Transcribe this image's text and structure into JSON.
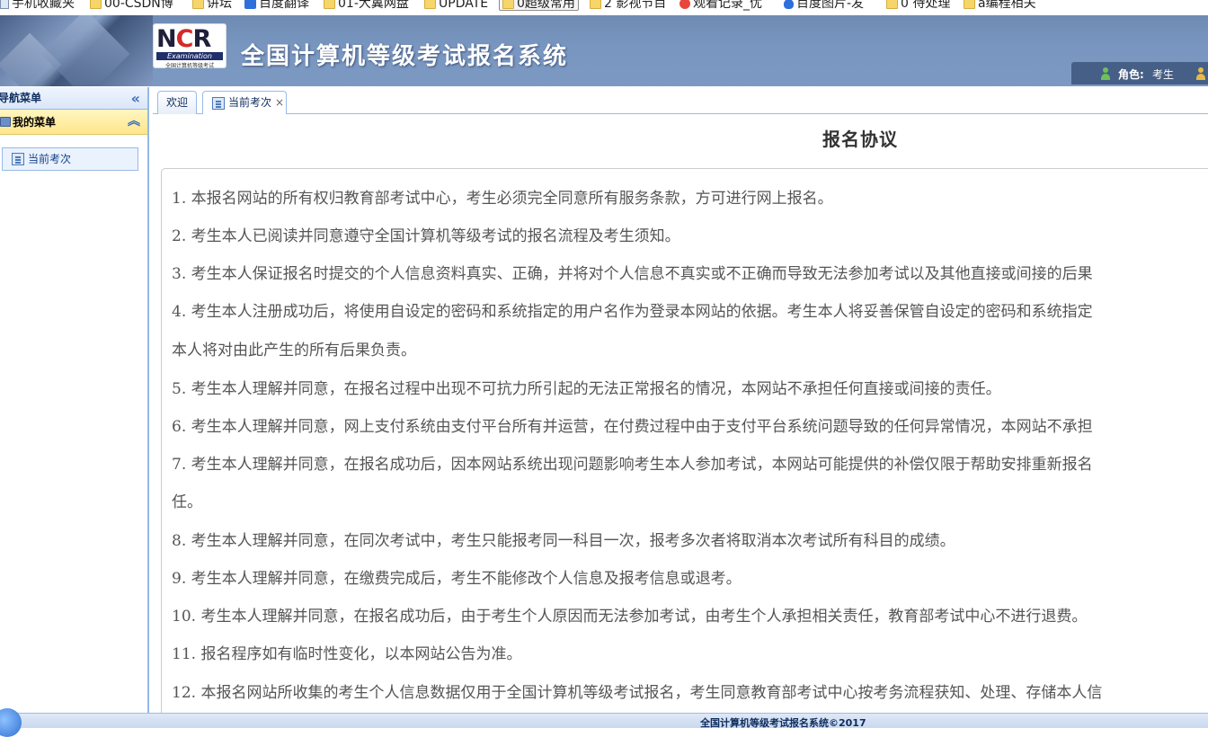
{
  "bookmarks": [
    {
      "label": "手机收藏夹",
      "icon": "page-icon"
    },
    {
      "label": "00-CSDN博",
      "icon": "folder-icon"
    },
    {
      "label": "讲坛",
      "icon": "folder-icon"
    },
    {
      "label": "百度翻译",
      "icon": "baidu-translate-icon"
    },
    {
      "label": "01-大翼网盘",
      "icon": "folder-icon"
    },
    {
      "label": "UPDATE",
      "icon": "folder-icon"
    },
    {
      "label": "0超级常用",
      "icon": "folder-icon"
    },
    {
      "label": "2 影视节目",
      "icon": "folder-icon"
    },
    {
      "label": "观看记录_优",
      "icon": "youku-icon"
    },
    {
      "label": "百度图片-发",
      "icon": "baidu-paw-icon"
    },
    {
      "label": "0 待处理",
      "icon": "folder-icon"
    },
    {
      "label": "a编程相关",
      "icon": "folder-icon"
    }
  ],
  "header": {
    "logo": {
      "letters": "NCR",
      "subtitle": "Examination",
      "tagline": "全国计算机等级考试"
    },
    "title": "全国计算机等级考试报名系统",
    "role_label": "角色:",
    "role_value": "考生"
  },
  "nav": {
    "title": "导航菜单",
    "section_title": "我的菜单",
    "items": [
      {
        "label": "当前考次",
        "icon": "list-icon"
      }
    ]
  },
  "tabs": [
    {
      "label": "欢迎"
    },
    {
      "label": "当前考次",
      "icon": "list-icon",
      "closable": true
    }
  ],
  "content": {
    "title": "报名协议",
    "clauses": [
      "1. 本报名网站的所有权归教育部考试中心，考生必须完全同意所有服务条款，方可进行网上报名。",
      "2. 考生本人已阅读并同意遵守全国计算机等级考试的报名流程及考生须知。",
      "3. 考生本人保证报名时提交的个人信息资料真实、正确，并将对个人信息不真实或不正确而导致无法参加考试以及其他直接或间接的后果",
      "4. 考生本人注册成功后，将使用自设定的密码和系统指定的用户名作为登录本网站的依据。考生本人将妥善保管自设定的密码和系统指定",
      "本人将对由此产生的所有后果负责。",
      "5. 考生本人理解并同意，在报名过程中出现不可抗力所引起的无法正常报名的情况，本网站不承担任何直接或间接的责任。",
      "6. 考生本人理解并同意，网上支付系统由支付平台所有并运营，在付费过程中由于支付平台系统问题导致的任何异常情况，本网站不承担",
      "7. 考生本人理解并同意，在报名成功后，因本网站系统出现问题影响考生本人参加考试，本网站可能提供的补偿仅限于帮助安排重新报名",
      "任。",
      "8. 考生本人理解并同意，在同次考试中，考生只能报考同一科目一次，报考多次者将取消本次考试所有科目的成绩。",
      "9. 考生本人理解并同意，在缴费完成后，考生不能修改个人信息及报考信息或退考。",
      "10. 考生本人理解并同意，在报名成功后，由于考生个人原因而无法参加考试，由考生个人承担相关责任，教育部考试中心不进行退费。",
      "11. 报名程序如有临时性变化，以本网站公告为准。",
      "12. 本报名网站所收集的考生个人信息数据仅用于全国计算机等级考试报名，考生同意教育部考试中心按考务流程获知、处理、存储本人信"
    ]
  },
  "footer": {
    "text": "全国计算机等级考试报名系统©2017"
  },
  "colors": {
    "header_bg": "#7896bf",
    "nav_section_bg": "#ffe68a",
    "border": "#99bbe8",
    "text": "#555555"
  }
}
